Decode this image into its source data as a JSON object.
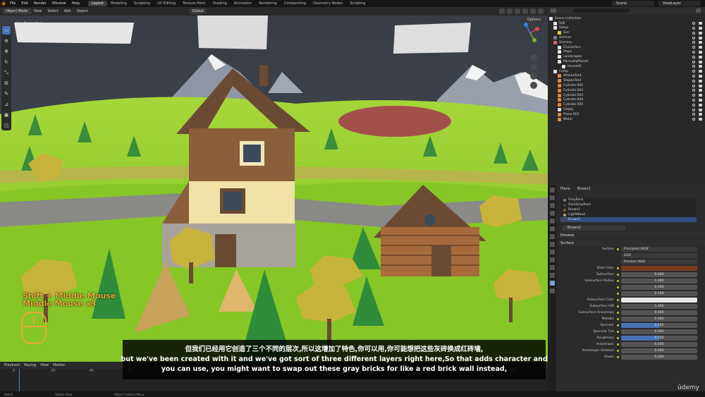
{
  "topbar": {
    "menus": [
      "File",
      "Edit",
      "Render",
      "Window",
      "Help"
    ],
    "workspaces": [
      "Layout",
      "Modeling",
      "Sculpting",
      "UV Editing",
      "Texture Paint",
      "Shading",
      "Animation",
      "Rendering",
      "Compositing",
      "Geometry Nodes",
      "Scripting"
    ],
    "active_workspace": "Layout",
    "scene": "Scene",
    "view_layer": "ViewLayer"
  },
  "viewport_header": {
    "mode": "Object Mode",
    "menus": [
      "View",
      "Select",
      "Add",
      "Object"
    ],
    "transform": "Global",
    "options": "Options"
  },
  "viewport": {
    "view_name": "User Perspective",
    "view_subtitle": "(1) Camp | Plane",
    "key_hint_1": "Shift + Middle Mouse",
    "key_hint_2": "Middle Mouse x3"
  },
  "timeline": {
    "menus": [
      "Playback",
      "Keying",
      "View",
      "Marker"
    ],
    "frame_numbers": [
      "0",
      "20",
      "40",
      "60",
      "80",
      "100",
      "120",
      "140",
      "160",
      "180",
      "200",
      "220",
      "240",
      "260"
    ],
    "status": [
      "Select",
      "Rotate View",
      "Object Context Menu"
    ]
  },
  "outliner": {
    "items": [
      {
        "label": "Scene Collection",
        "color": "#e2e2e2"
      },
      {
        "label": "Still",
        "color": "#e2e2e2"
      },
      {
        "label": "Setup",
        "color": "#e2e2e2"
      },
      {
        "label": "Sun",
        "color": "#e5c94a"
      },
      {
        "label": "Archive",
        "color": "#7a7a7a"
      },
      {
        "label": "Scenery",
        "color": "#e06060"
      },
      {
        "label": "Characters",
        "color": "#e2e2e2"
      },
      {
        "label": "Props",
        "color": "#e2e2e2"
      },
      {
        "label": "Landscapes",
        "color": "#e2e2e2"
      },
      {
        "label": "ManuallyPlaced",
        "color": "#e2e2e2"
      },
      {
        "label": "House01",
        "color": "#e2e2e2"
      },
      {
        "label": "Camp",
        "color": "#e2e2e2"
      },
      {
        "label": "AframeTent",
        "color": "#e08a3a"
      },
      {
        "label": "TeepeeTent",
        "color": "#e08a3a"
      },
      {
        "label": "Cylinder.001",
        "color": "#e08a3a"
      },
      {
        "label": "Cylinder.002",
        "color": "#e08a3a"
      },
      {
        "label": "Cylinder.003",
        "color": "#e08a3a"
      },
      {
        "label": "Cylinder.004",
        "color": "#e08a3a"
      },
      {
        "label": "Cylinder.005",
        "color": "#e08a3a"
      },
      {
        "label": "Empty",
        "color": "#e2e2e2"
      },
      {
        "label": "Plane.003",
        "color": "#e08a3a"
      },
      {
        "label": "Water",
        "color": "#e08a3a"
      }
    ]
  },
  "properties": {
    "object": "Plane",
    "material": "Brown2",
    "material_slots": [
      {
        "label": "GreyRock",
        "color": "#7c7c7c"
      },
      {
        "label": "DarkGreyRock",
        "color": "#4a4a4a"
      },
      {
        "label": "Brown1",
        "color": "#8a5a32"
      },
      {
        "label": "LightWood",
        "color": "#c9a46a"
      },
      {
        "label": "Brown2",
        "color": "#6a3d22"
      }
    ],
    "preview": "Preview",
    "surface_section": "Surface",
    "surface_shader": "Principled BSDF",
    "distribution": "GGX",
    "subsurface_method": "Random Walk",
    "rows": [
      {
        "label": "Base Color",
        "value": "",
        "fill": 0,
        "color": "#7a3d1e"
      },
      {
        "label": "Subsurface",
        "value": "0.000",
        "fill": 0
      },
      {
        "label": "Subsurface Radius",
        "value": "1.000",
        "fill": 0
      },
      {
        "label": "",
        "value": "0.200",
        "fill": 0
      },
      {
        "label": "",
        "value": "0.100",
        "fill": 0
      },
      {
        "label": "Subsurface Color",
        "value": "",
        "fill": 0,
        "color": "#e8e8e8"
      },
      {
        "label": "Subsurface IOR",
        "value": "1.400",
        "fill": 0
      },
      {
        "label": "Subsurface Anisotropy",
        "value": "0.000",
        "fill": 0
      },
      {
        "label": "Metallic",
        "value": "0.000",
        "fill": 0
      },
      {
        "label": "Specular",
        "value": "0.500",
        "fill": 0.5
      },
      {
        "label": "Specular Tint",
        "value": "0.000",
        "fill": 0
      },
      {
        "label": "Roughness",
        "value": "0.500",
        "fill": 0.5
      },
      {
        "label": "Anisotropic",
        "value": "0.000",
        "fill": 0
      },
      {
        "label": "Anisotropic Rotation",
        "value": "0.000",
        "fill": 0
      },
      {
        "label": "Sheen",
        "value": "0.000",
        "fill": 0
      }
    ]
  },
  "subtitles": {
    "line_zh": "但我们已经用它创造了三个不同的层次,所以这增加了特色,你可以用,你可能想把这些灰砖换成红砖墙,",
    "line_en_1": "but we've been created with it and we've got sort of three different layers right here,So that adds character and",
    "line_en_2": "you can use, you might want to swap out these gray bricks for like a red brick wall instead,"
  },
  "watermark": "ûdemy"
}
